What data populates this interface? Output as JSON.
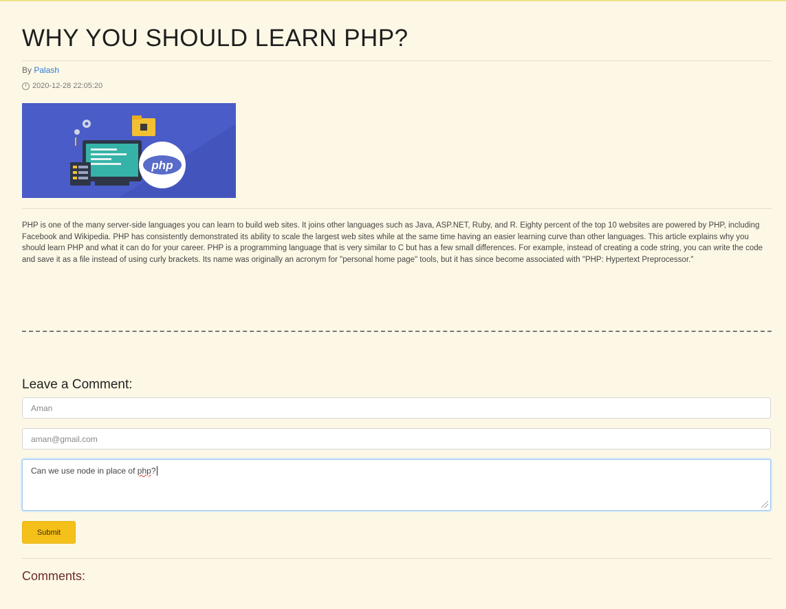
{
  "article": {
    "title": "WHY YOU SHOULD LEARN PHP?",
    "by_prefix": "By",
    "author": "Palash",
    "date": "2020-12-28 22:05:20",
    "image_label": "php",
    "body": "PHP is one of the many server-side languages you can learn to build web sites. It joins other languages such as Java, ASP.NET, Ruby, and R. Eighty percent of the top 10 websites are powered by PHP, including Facebook and Wikipedia. PHP has consistently demonstrated its ability to scale the largest web sites while at the same time having an easier learning curve than other languages. This article explains why you should learn PHP and what it can do for your career. PHP is a programming language that is very similar to C but has a few small differences. For example, instead of creating a code string, you can write the code and save it as a file instead of using curly brackets. Its name was originally an acronym for \"personal home page\" tools, but it has since become associated with \"PHP: Hypertext Preprocessor.\""
  },
  "comment_form": {
    "heading": "Leave a Comment:",
    "name_value": "Aman",
    "email_value": "aman@gmail.com",
    "comment_text_before": "Can we use node in place of ",
    "comment_text_misspelled": "php",
    "comment_text_after": "?",
    "submit_label": "Submit"
  },
  "comments": {
    "heading": "Comments:"
  },
  "colors": {
    "page_background": "#fdf8e6",
    "link": "#2b7bd6",
    "submit_button": "#f5c01a",
    "comments_heading": "#6b2a2a",
    "hero_background": "#4a5cc7"
  },
  "icons": {
    "date": "clock-icon",
    "resize": "resize-handle-icon"
  }
}
